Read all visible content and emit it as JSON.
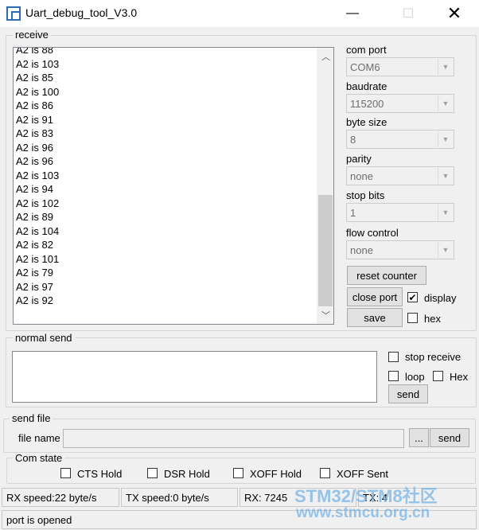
{
  "window": {
    "title": "Uart_debug_tool_V3.0",
    "minimize_glyph": "—",
    "maximize_glyph": "☐",
    "close_glyph": "✕"
  },
  "receive": {
    "label": "receive",
    "lines": [
      "A2 is 88",
      "A2 is 103",
      "A2 is 85",
      "A2 is 100",
      "A2 is 86",
      "A2 is 91",
      "A2 is 83",
      "A2 is 96",
      "A2 is 96",
      "A2 is 103",
      "A2 is 94",
      "A2 is 102",
      "A2 is 89",
      "A2 is 104",
      "A2 is 82",
      "A2 is 101",
      "A2 is 79",
      "A2 is 97",
      "A2 is 92"
    ],
    "scroll_up_glyph": "︿",
    "scroll_down_glyph": "﹀"
  },
  "settings": {
    "com_port": {
      "label": "com port",
      "value": "COM6"
    },
    "baudrate": {
      "label": "baudrate",
      "value": "115200"
    },
    "byte_size": {
      "label": "byte size",
      "value": "8"
    },
    "parity": {
      "label": "parity",
      "value": "none"
    },
    "stop_bits": {
      "label": "stop bits",
      "value": "1"
    },
    "flow_control": {
      "label": "flow control",
      "value": "none"
    },
    "dropdown_glyph": "▼"
  },
  "controls": {
    "reset_counter": "reset counter",
    "close_port": "close port",
    "save": "save",
    "display": {
      "label": "display",
      "checked": true,
      "mark": "✔"
    },
    "hex": {
      "label": "hex",
      "checked": false
    }
  },
  "normal_send": {
    "label": "normal send",
    "text": "",
    "stop_receive": {
      "label": "stop receive",
      "checked": false
    },
    "loop": {
      "label": "loop",
      "checked": false
    },
    "hex": {
      "label": "Hex",
      "checked": false
    },
    "send": "send"
  },
  "send_file": {
    "label": "send file",
    "file_name_label": "file name",
    "file_name_value": "",
    "browse": "...",
    "send": "send"
  },
  "com_state": {
    "label": "Com state",
    "cts": "CTS Hold",
    "dsr": "DSR Hold",
    "xoff_hold": "XOFF Hold",
    "xoff_sent": "XOFF Sent"
  },
  "status": {
    "rx_speed": "RX speed:22 byte/s",
    "tx_speed": "TX speed:0 byte/s",
    "rx": "RX: 7245",
    "tx": "TX: 4",
    "port": "port is opened"
  },
  "watermark": {
    "line1": "STM32/STM8社区",
    "line2": "www.stmcu.org.cn"
  }
}
